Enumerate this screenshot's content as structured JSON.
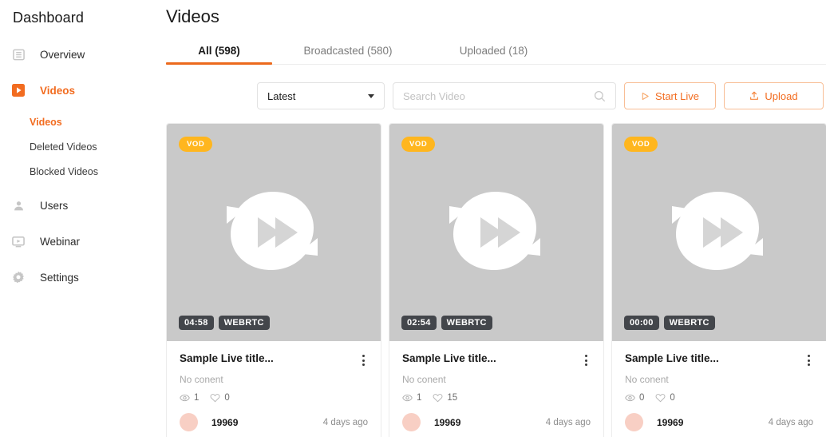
{
  "sidebar": {
    "brand": "Dashboard",
    "items": [
      {
        "label": "Overview",
        "icon": "list-icon",
        "active": false
      },
      {
        "label": "Videos",
        "icon": "video-play-icon",
        "active": true
      },
      {
        "label": "Users",
        "icon": "user-icon",
        "active": false
      },
      {
        "label": "Webinar",
        "icon": "monitor-play-icon",
        "active": false
      },
      {
        "label": "Settings",
        "icon": "gear-icon",
        "active": false
      }
    ],
    "sub_items": [
      {
        "label": "Videos",
        "active": true
      },
      {
        "label": "Deleted Videos",
        "active": false
      },
      {
        "label": "Blocked Videos",
        "active": false
      }
    ]
  },
  "header": {
    "title": "Videos"
  },
  "tabs": [
    {
      "label": "All (598)",
      "active": true
    },
    {
      "label": "Broadcasted (580)",
      "active": false
    },
    {
      "label": "Uploaded (18)",
      "active": false
    }
  ],
  "toolbar": {
    "sort_value": "Latest",
    "search_placeholder": "Search Video",
    "search_value": "",
    "search_icon": "search-icon",
    "start_live_label": "Start Live",
    "start_live_icon": "play-outline-icon",
    "upload_label": "Upload",
    "upload_icon": "upload-icon"
  },
  "cards": [
    {
      "badge": "VOD",
      "duration": "04:58",
      "protocol": "WEBRTC",
      "title": "Sample Live title...",
      "description": "No conent",
      "views": "1",
      "likes": "0",
      "owner": "19969",
      "time_ago": "4 days ago",
      "thumbnail_icon": "fast-forward-placeholder-icon"
    },
    {
      "badge": "VOD",
      "duration": "02:54",
      "protocol": "WEBRTC",
      "title": "Sample Live title...",
      "description": "No conent",
      "views": "1",
      "likes": "15",
      "owner": "19969",
      "time_ago": "4 days ago",
      "thumbnail_icon": "fast-forward-placeholder-icon"
    },
    {
      "badge": "VOD",
      "duration": "00:00",
      "protocol": "WEBRTC",
      "title": "Sample Live title...",
      "description": "No conent",
      "views": "0",
      "likes": "0",
      "owner": "19969",
      "time_ago": "4 days ago",
      "thumbnail_icon": "fast-forward-placeholder-icon"
    }
  ],
  "colors": {
    "accent": "#F26C20",
    "tab_underline": "#EC6A1D",
    "badge_vod": "#FFB61E",
    "chip": "#43464B",
    "thumbnail_bg": "#C9C9C9",
    "avatar": "#F8CFC4"
  }
}
